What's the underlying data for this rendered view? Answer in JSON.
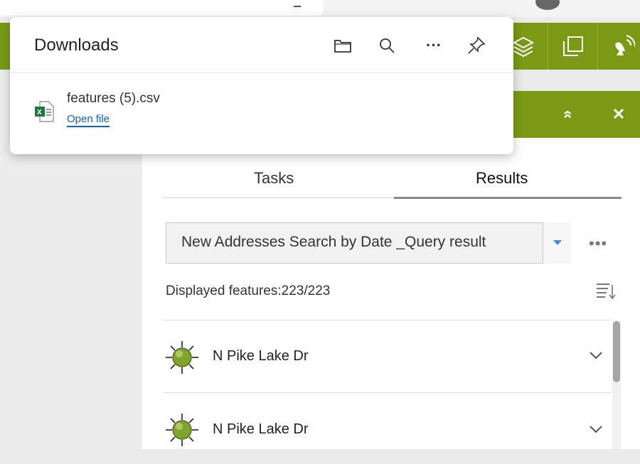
{
  "downloads": {
    "title": "Downloads",
    "icons": [
      "folder-icon",
      "search-icon",
      "more-icon",
      "pin-icon"
    ],
    "more_label": "···",
    "file": {
      "name": "features (5).csv",
      "action": "Open file",
      "icon": "excel-file-icon"
    }
  },
  "toolbar": {
    "icons": [
      "layers-icon",
      "overview-icon",
      "satellite-icon"
    ],
    "color": "#7a9a14"
  },
  "widget": {
    "header_icons": [
      "collapse-icon",
      "close-icon"
    ],
    "collapse_label": "»",
    "close_label": "✕",
    "tabs": [
      {
        "label": "Tasks",
        "active": false
      },
      {
        "label": "Results",
        "active": true
      }
    ],
    "layer_select": {
      "value": "New Addresses Search by Date _Query result"
    },
    "more_label": "•••",
    "displayed": "Displayed features:223/223",
    "results": [
      {
        "label": "N Pike Lake Dr"
      },
      {
        "label": "N Pike Lake Dr"
      }
    ]
  }
}
